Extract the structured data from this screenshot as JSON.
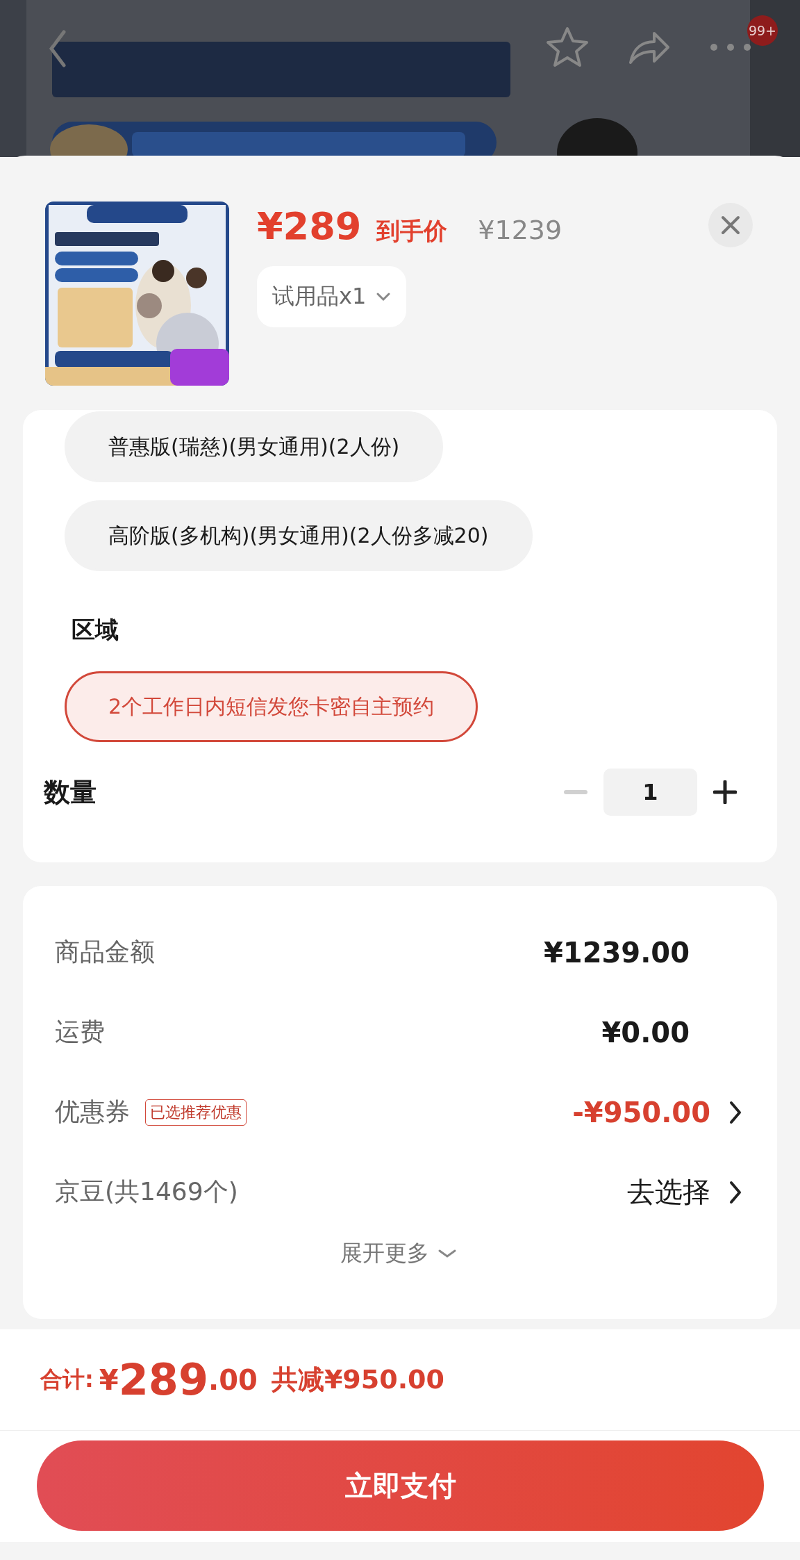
{
  "nav": {
    "badge": "99+"
  },
  "product": {
    "price": "¥289",
    "price_note": "到手价",
    "original_price": "¥1239",
    "variant": "试用品x1"
  },
  "options": [
    {
      "label": "普惠版(瑞慈)(男女通用)(2人份)",
      "selected": false
    },
    {
      "label": "高阶版(多机构)(男女通用)(2人份多减20)",
      "selected": false
    }
  ],
  "region": {
    "title": "区域",
    "options": [
      {
        "label": "2个工作日内短信发您卡密自主预约",
        "selected": true
      }
    ]
  },
  "quantity": {
    "label": "数量",
    "value": "1",
    "minus_disabled": true
  },
  "summary": {
    "rows": [
      {
        "label": "商品金额",
        "value": "¥1239.00",
        "kind": "plain"
      },
      {
        "label": "运费",
        "value": "¥0.00",
        "kind": "plain"
      },
      {
        "label": "优惠券",
        "tag": "已选推荐优惠",
        "value": "-¥950.00",
        "kind": "discount"
      },
      {
        "label": "京豆(共1469个)",
        "value": "去选择",
        "kind": "link"
      }
    ],
    "expand": "展开更多"
  },
  "footer": {
    "total_label": "合计:",
    "total_currency": "¥",
    "total_main": "289",
    "total_decimal": ".00",
    "savings": "共减¥950.00",
    "pay_button": "立即支付"
  }
}
